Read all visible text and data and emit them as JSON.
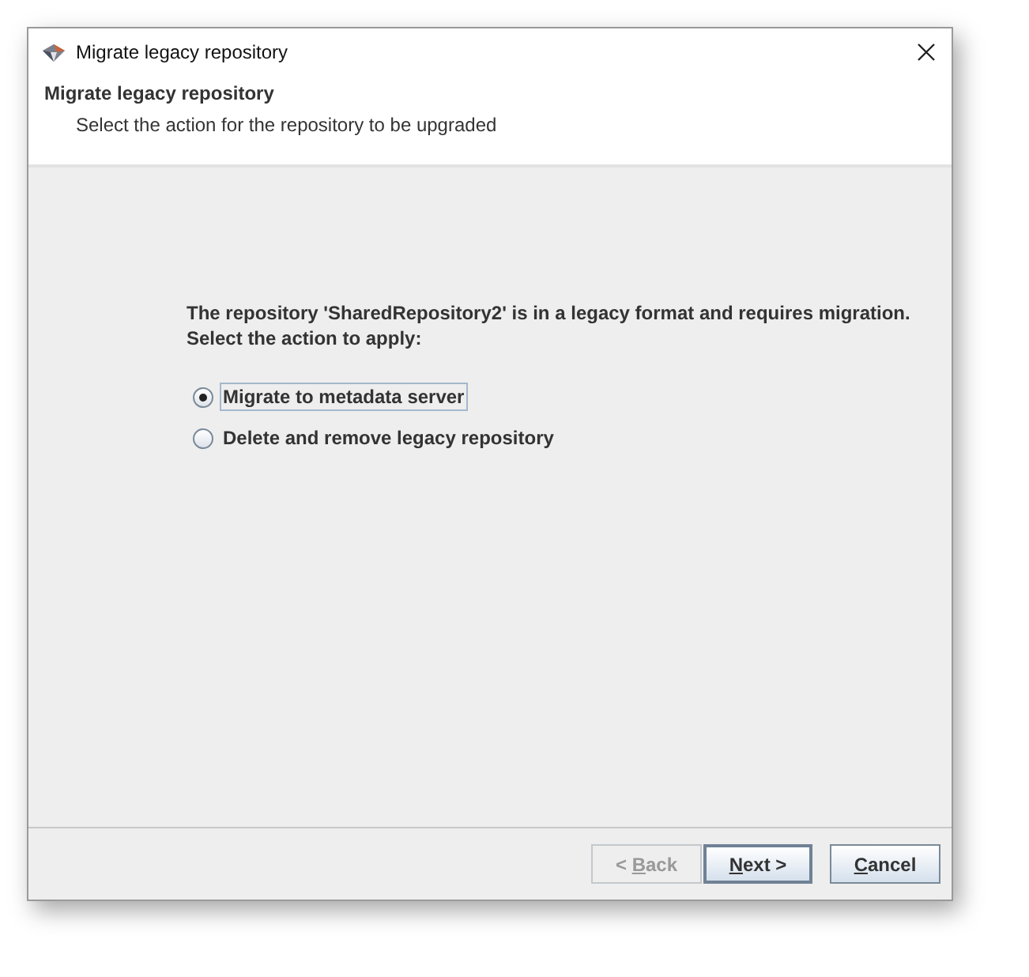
{
  "window": {
    "title": "Migrate legacy repository"
  },
  "header": {
    "title": "Migrate legacy repository",
    "subtitle": "Select the action for the repository to be upgraded"
  },
  "message": {
    "lines": [
      "The repository 'SharedRepository2' is in a legacy format and requires migration.",
      "Select the action to apply:"
    ]
  },
  "options": [
    {
      "label": "Migrate to metadata server",
      "selected": true,
      "focused": true
    },
    {
      "label": "Delete and remove legacy repository",
      "selected": false,
      "focused": false
    }
  ],
  "buttons": [
    {
      "before": "< ",
      "mnemonic": "B",
      "after": "ack",
      "disabled": true,
      "default": false
    },
    {
      "mnemonic": "N",
      "after": "ext >",
      "disabled": false,
      "default": true
    },
    {
      "mnemonic": "C",
      "after": "ancel",
      "disabled": false,
      "default": false
    }
  ]
}
